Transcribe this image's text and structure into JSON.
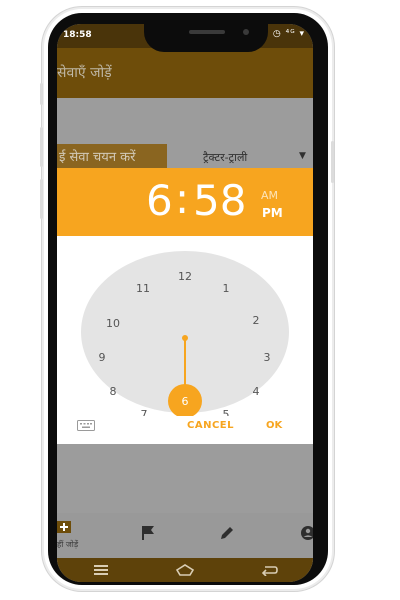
{
  "status": {
    "time": "18:58",
    "icons_text": "◷ ⁴ᴳ ▾"
  },
  "appbar": {
    "title": "सेवाएँ जोड़ें"
  },
  "form": {
    "service_button_label": "ई सेवा चयन करें",
    "service_selected": "ट्रैक्टर-ट्राली"
  },
  "time_picker": {
    "hour": "6",
    "minute": "58",
    "separator": ":",
    "am_label": "AM",
    "pm_label": "PM",
    "selected_period": "PM",
    "accent_color": "#f7a51f",
    "clock_numbers": [
      "12",
      "1",
      "2",
      "3",
      "4",
      "5",
      "6",
      "7",
      "8",
      "9",
      "10",
      "11"
    ],
    "selected_number": "6",
    "cancel_label": "CANCEL",
    "ok_label": "OK"
  },
  "bottom_nav": {
    "home_label": "हीं जोड़ें",
    "icons": [
      "plus-icon",
      "flag-icon",
      "pencil-icon",
      "profile-icon"
    ]
  },
  "system_nav": {
    "icons": [
      "menu-icon",
      "home-icon",
      "back-icon"
    ]
  }
}
